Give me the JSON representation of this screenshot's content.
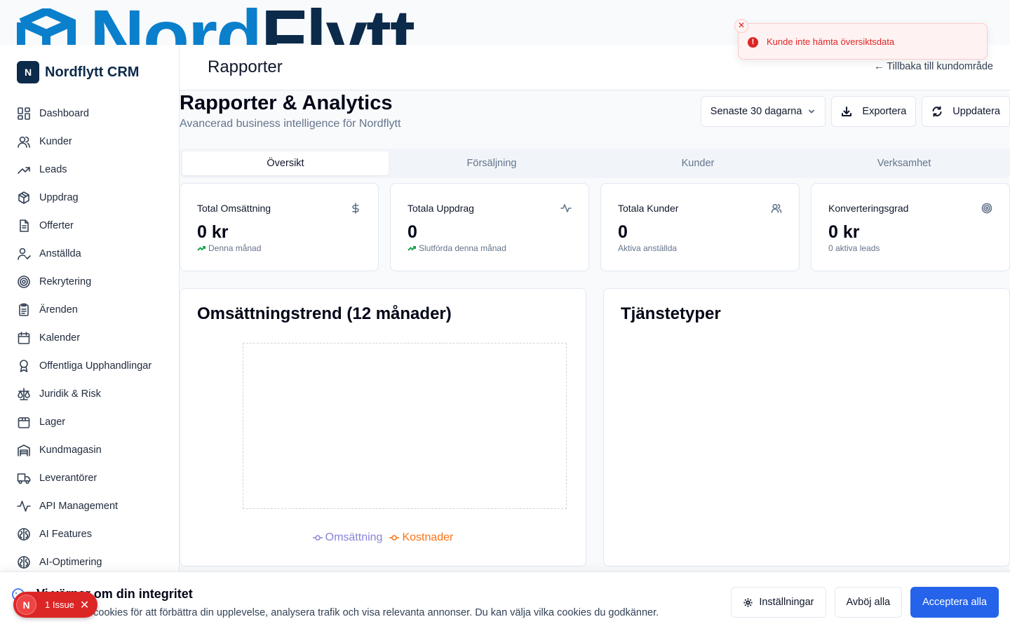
{
  "banner": {
    "wordmark_part1": "Nord",
    "wordmark_part2": "Flytt"
  },
  "sidebar": {
    "brand_initial": "N",
    "brand_name": "Nordflytt CRM",
    "items": [
      {
        "label": "Dashboard",
        "icon": "dashboard-icon"
      },
      {
        "label": "Kunder",
        "icon": "users-icon"
      },
      {
        "label": "Leads",
        "icon": "trending-up-icon"
      },
      {
        "label": "Uppdrag",
        "icon": "package-icon"
      },
      {
        "label": "Offerter",
        "icon": "document-icon"
      },
      {
        "label": "Anställda",
        "icon": "user-check-icon"
      },
      {
        "label": "Rekrytering",
        "icon": "target-icon"
      },
      {
        "label": "Ärenden",
        "icon": "clipboard-icon"
      },
      {
        "label": "Kalender",
        "icon": "calendar-icon"
      },
      {
        "label": "Offentliga Upphandlingar",
        "icon": "award-icon"
      },
      {
        "label": "Juridik & Risk",
        "icon": "scale-icon"
      },
      {
        "label": "Lager",
        "icon": "box-icon"
      },
      {
        "label": "Kundmagasin",
        "icon": "warehouse-icon"
      },
      {
        "label": "Leverantörer",
        "icon": "truck-icon"
      },
      {
        "label": "API Management",
        "icon": "activity-icon"
      },
      {
        "label": "AI Features",
        "icon": "brain-icon"
      },
      {
        "label": "AI-Optimering",
        "icon": "brain-icon"
      }
    ]
  },
  "header": {
    "title": "Rapporter",
    "back_link": "← Tillbaka till kundområde"
  },
  "main": {
    "title": "Rapporter & Analytics",
    "subtitle": "Avancerad business intelligence för Nordflytt",
    "period_select": "Senaste 30 dagarna",
    "export_label": "Exportera",
    "refresh_label": "Uppdatera",
    "tabs": [
      {
        "label": "Översikt",
        "active": true
      },
      {
        "label": "Försäljning",
        "active": false
      },
      {
        "label": "Kunder",
        "active": false
      },
      {
        "label": "Verksamhet",
        "active": false
      }
    ],
    "stats": [
      {
        "title": "Total Omsättning",
        "value": "0 kr",
        "sub": "Denna månad",
        "trend": true,
        "icon": "dollar-icon"
      },
      {
        "title": "Totala Uppdrag",
        "value": "0",
        "sub": "Slutförda denna månad",
        "trend": true,
        "icon": "activity-icon"
      },
      {
        "title": "Totala Kunder",
        "value": "0",
        "sub": "Aktiva anställda",
        "trend": false,
        "icon": "users-icon"
      },
      {
        "title": "Konverteringsgrad",
        "value": "0 kr",
        "sub": "0 aktiva leads",
        "trend": false,
        "icon": "target-icon"
      }
    ],
    "revenue_panel": {
      "title": "Omsättningstrend (12 månader)",
      "legend": [
        {
          "name": "Omsättning",
          "color": "#8884d8"
        },
        {
          "name": "Kostnader",
          "color": "#f97316"
        }
      ]
    },
    "service_panel": {
      "title": "Tjänstetyper"
    }
  },
  "toast": {
    "message": "Kunde inte hämta översiktsdata",
    "color": "#dc2626"
  },
  "cookie": {
    "title": "Vi värnar om din integritet",
    "text": "Vi använder cookies för att förbättra din upplevelse, analysera trafik och visa relevanta annonser. Du kan välja vilka cookies du godkänner.",
    "settings_label": "Inställningar",
    "reject_label": "Avböj alla",
    "accept_label": "Acceptera alla",
    "accent": "#2563eb"
  },
  "issue_badge": {
    "initial": "N",
    "label": "1 Issue"
  }
}
